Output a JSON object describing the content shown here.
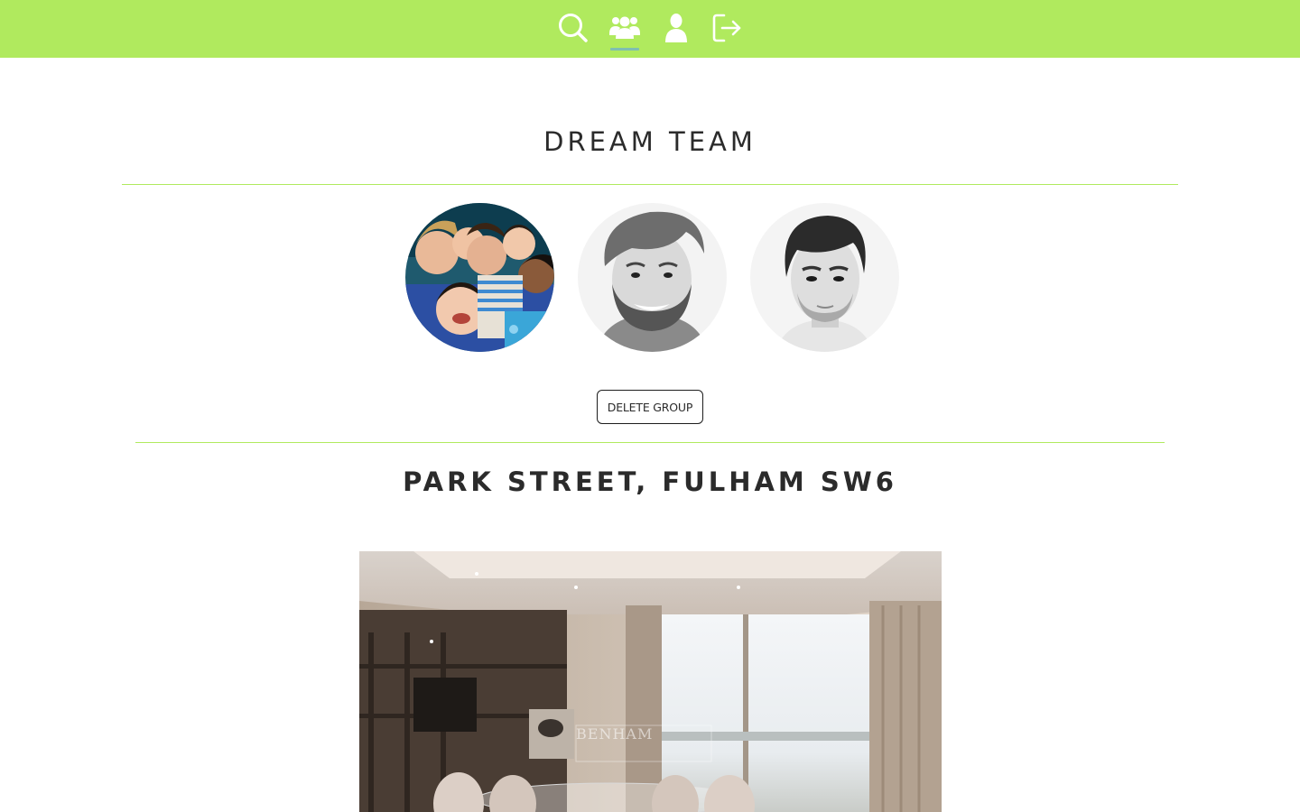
{
  "nav": {
    "items": [
      {
        "name": "search",
        "icon": "search-icon",
        "active": false
      },
      {
        "name": "groups",
        "icon": "users-icon",
        "active": true
      },
      {
        "name": "profile",
        "icon": "user-icon",
        "active": false
      },
      {
        "name": "logout",
        "icon": "sign-out-icon",
        "active": false
      }
    ]
  },
  "group": {
    "title": "DREAM TEAM",
    "members": [
      {
        "avatar": "group-selfie-photo"
      },
      {
        "avatar": "bearded-man-photo"
      },
      {
        "avatar": "dark-haired-man-photo"
      }
    ],
    "delete_label": "DELETE GROUP"
  },
  "property": {
    "title": "PARK STREET, FULHAM SW6",
    "photo": "dining-room-interior-photo",
    "watermark": "BENHAM"
  },
  "colors": {
    "accent": "#b0ea5e",
    "text": "#2b2b2b",
    "nav_icon": "#ffffff",
    "active_underline": "#7fbfb0"
  }
}
